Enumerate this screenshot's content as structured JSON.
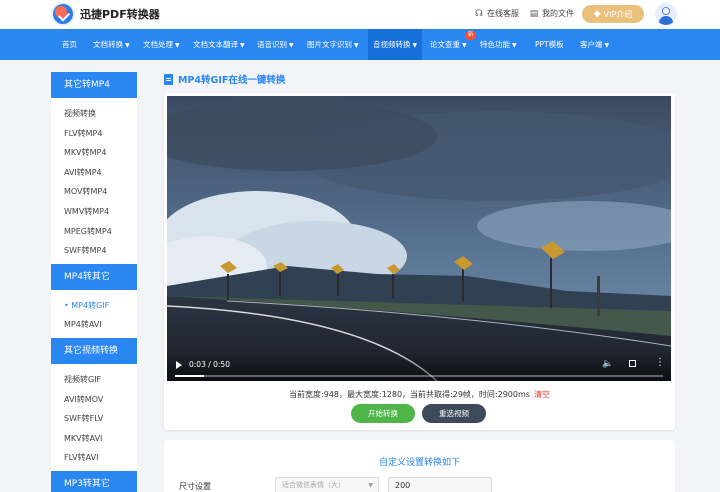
{
  "header": {
    "logo_text": "迅捷PDF转换器",
    "online_service": "在线客服",
    "my_files": "我的文件",
    "vip_label": "VIP介绍",
    "brand_color": "#2a86f0"
  },
  "nav": {
    "items": [
      {
        "label": "首页",
        "caret": ""
      },
      {
        "label": "文档转换",
        "caret": "▼"
      },
      {
        "label": "文档处理",
        "caret": "▼"
      },
      {
        "label": "文档文本翻译",
        "caret": "▼"
      },
      {
        "label": "语音识别",
        "caret": "▼"
      },
      {
        "label": "图片文字识别",
        "caret": "▼"
      },
      {
        "label": "音视频转换",
        "caret": "▼"
      },
      {
        "label": "论文查重",
        "caret": "▼"
      },
      {
        "label": "特色功能",
        "caret": "▼"
      },
      {
        "label": "PPT模板",
        "caret": ""
      },
      {
        "label": "客户端",
        "caret": "▼"
      }
    ],
    "new_badge": "新"
  },
  "sidebar": {
    "group1": {
      "title": "其它转MP4",
      "items": [
        "视频转换",
        "FLV转MP4",
        "MKV转MP4",
        "AVI转MP4",
        "MOV转MP4",
        "WMV转MP4",
        "MPEG转MP4",
        "SWF转MP4"
      ]
    },
    "group2": {
      "title": "MP4转其它",
      "items": [
        "MP4转GIF",
        "MP4转AVI"
      ]
    },
    "group3": {
      "title": "其它视频转换",
      "items": [
        "视频转GIF",
        "AVI转MOV",
        "SWF转FLV",
        "MKV转AVI",
        "FLV转AVI"
      ]
    },
    "group4": {
      "title": "MP3转其它"
    }
  },
  "main": {
    "title": "MP4转GIF在线一键转换",
    "video": {
      "time": "0:03 / 0:50",
      "progress": 0.06
    },
    "info": "当前宽度:948，最大宽度:1280，当前共取得:29帧，时间:2900ms",
    "clear_label": "清空",
    "start_button": "开始转换",
    "reselect_button": "重选视频",
    "settings": {
      "title": "自定义设置转换如下",
      "size_label": "尺寸设置",
      "size_select": "适合微信表情（大）",
      "size_value": "200"
    }
  }
}
